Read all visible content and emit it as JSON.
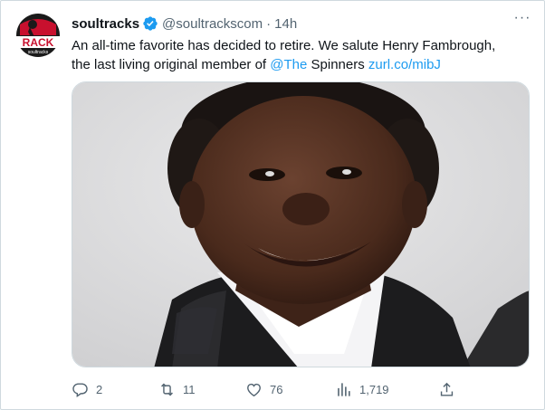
{
  "tweet": {
    "avatar_text": "RACK",
    "avatar_subtext": "soultracks",
    "display_name": "soultracks",
    "handle": "@soultrackscom",
    "separator": "·",
    "time": "14h",
    "more": "···",
    "text_line1": "An all-time favorite has decided to retire. We salute Henry Fambrough,",
    "text_line2_prefix": "the last living original member of ",
    "mention": "@The",
    "text_line2_middle": " Spinners ",
    "link": "zurl.co/mibJ"
  },
  "actions": {
    "reply_count": "2",
    "retweet_count": "11",
    "like_count": "76",
    "view_count": "1,719"
  },
  "colors": {
    "accent": "#1d9bf0",
    "muted": "#536471",
    "text": "#0f1419",
    "border": "#cfd9de",
    "avatar_red": "#c8102e"
  },
  "icons": [
    "verified-icon",
    "more-icon",
    "reply-icon",
    "retweet-icon",
    "like-icon",
    "views-icon",
    "share-icon"
  ]
}
